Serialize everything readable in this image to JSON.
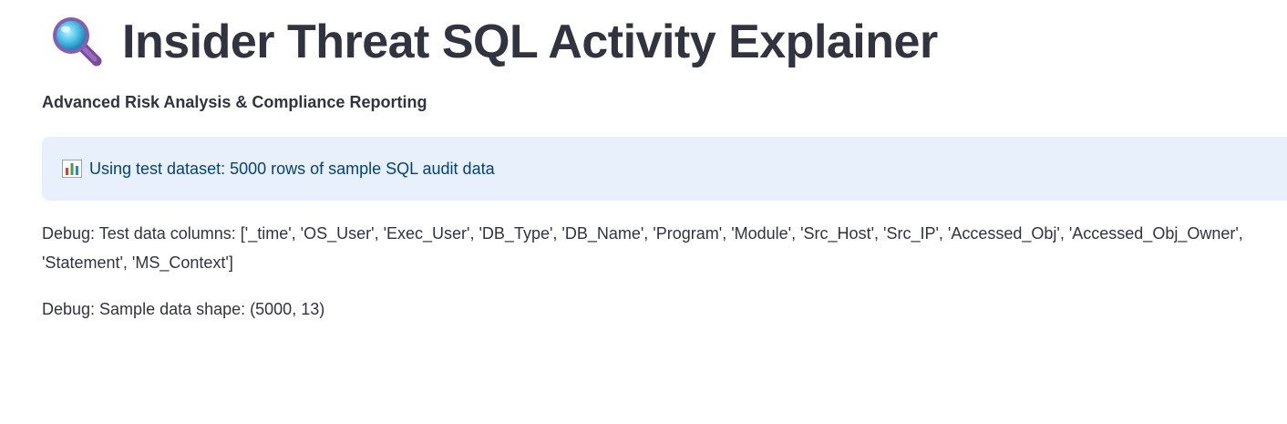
{
  "header": {
    "icon": "magnifying-glass-icon",
    "title": "Insider Threat SQL Activity Explainer",
    "subtitle": "Advanced Risk Analysis & Compliance Reporting"
  },
  "info_banner": {
    "icon": "bar-chart-icon",
    "text": "Using test dataset: 5000 rows of sample SQL audit data",
    "background_color": "#e8f1fb",
    "text_color": "#004280"
  },
  "debug": {
    "columns_text": "Debug: Test data columns: ['_time', 'OS_User', 'Exec_User', 'DB_Type', 'DB_Name', 'Program', 'Module', 'Src_Host', 'Src_IP', 'Accessed_Obj', 'Accessed_Obj_Owner', 'Statement', 'MS_Context']",
    "shape_text": "Debug: Sample data shape: (5000, 13)"
  }
}
